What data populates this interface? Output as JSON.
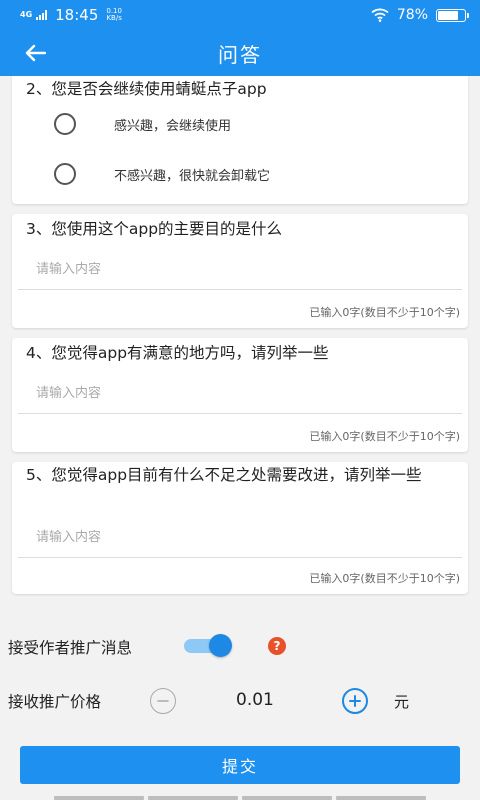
{
  "status_bar": {
    "network": "4G",
    "time": "18:45",
    "speed_value": "0.10",
    "speed_unit": "KB/s",
    "battery": "78%",
    "battery_level": 0.78
  },
  "header": {
    "title": "问答"
  },
  "questions": [
    {
      "title": "2、您是否会继续使用蜻蜓点子app",
      "options": [
        "感兴趣，会继续使用",
        "不感兴趣，很快就会卸载它"
      ]
    },
    {
      "title": "3、您使用这个app的主要目的是什么",
      "placeholder": "请输入内容",
      "counter": "已输入0字(数目不少于10个字)"
    },
    {
      "title": "4、您觉得app有满意的地方吗，请列举一些",
      "placeholder": "请输入内容",
      "counter": "已输入0字(数目不少于10个字)"
    },
    {
      "title": "5、您觉得app目前有什么不足之处需要改进，请列举一些",
      "placeholder": "请输入内容",
      "counter": "已输入0字(数目不少于10个字)"
    }
  ],
  "settings": {
    "promo_label": "接受作者推广消息",
    "promo_enabled": true,
    "help_symbol": "?",
    "price_label": "接收推广价格",
    "price_value": "0.01",
    "price_unit": "元"
  },
  "submit_label": "提交",
  "colors": {
    "primary": "#1e90f0",
    "toggle_track": "#8ec9f5",
    "help_badge": "#e8522a"
  }
}
